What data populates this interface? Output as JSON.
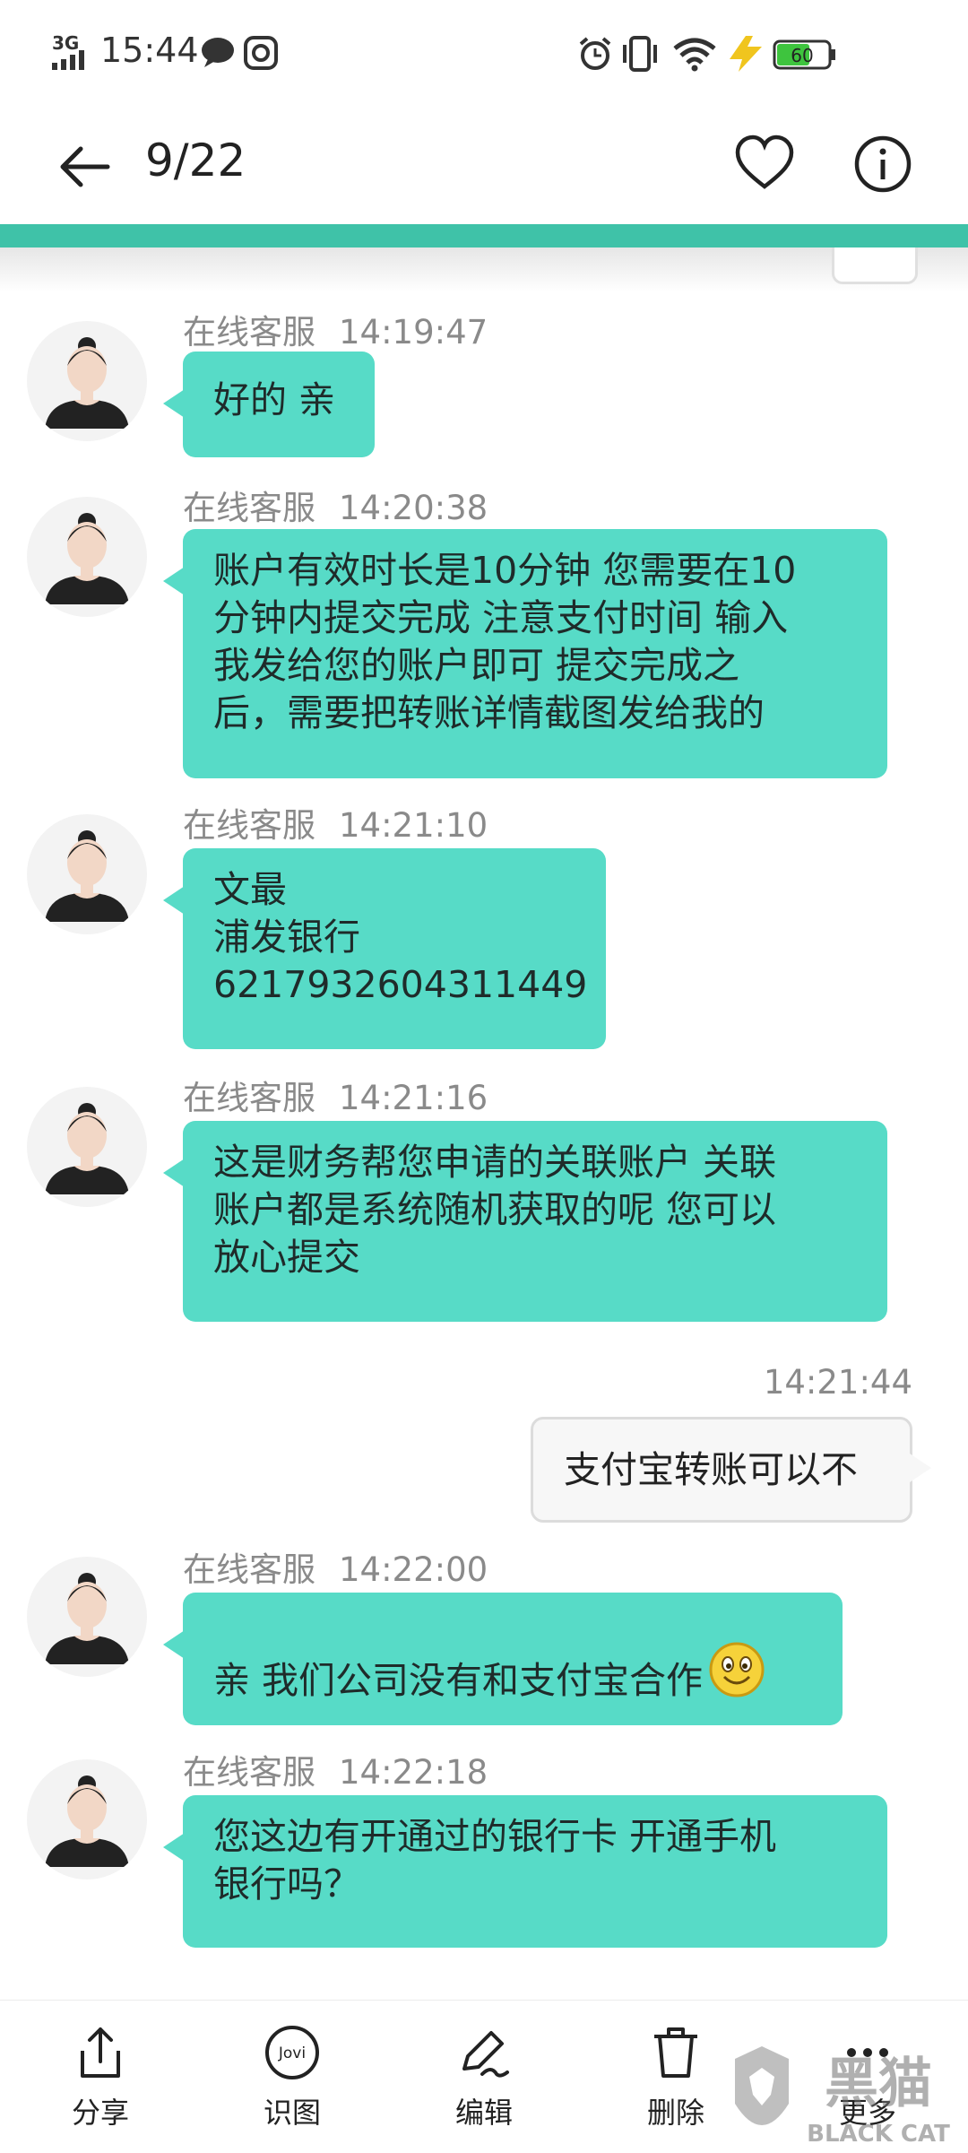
{
  "status_bar": {
    "network": "3G",
    "time": "15:44",
    "battery": "60"
  },
  "header": {
    "counter": "9/22"
  },
  "messages": [
    {
      "sender": "在线客服",
      "time": "14:19:47",
      "lines": [
        "好的 亲"
      ]
    },
    {
      "sender": "在线客服",
      "time": "14:20:38",
      "lines": [
        "账户有效时长是10分钟 您需要在10",
        "分钟内提交完成 注意支付时间 输入",
        "我发给您的账户即可 提交完成之",
        "后，需要把转账详情截图发给我的"
      ]
    },
    {
      "sender": "在线客服",
      "time": "14:21:10",
      "lines": [
        "文最",
        "浦发银行",
        "6217932604311449"
      ]
    },
    {
      "sender": "在线客服",
      "time": "14:21:16",
      "lines": [
        "这是财务帮您申请的关联账户 关联",
        "账户都是系统随机获取的呢 您可以",
        "放心提交"
      ]
    },
    {
      "sender": "在线客服",
      "time": "14:22:00",
      "lines": [
        "亲 我们公司没有和支付宝合作"
      ]
    },
    {
      "sender": "在线客服",
      "time": "14:22:18",
      "lines": [
        "您这边有开通过的银行卡 开通手机",
        "银行吗？"
      ]
    }
  ],
  "outgoing": {
    "time": "14:21:44",
    "text": "支付宝转账可以不"
  },
  "toolbar": {
    "share": "分享",
    "recognize": "识图",
    "edit": "编辑",
    "delete": "删除",
    "more": "更多"
  },
  "watermark": {
    "text": "黑猫",
    "sub": "BLACK CAT"
  },
  "colors": {
    "accent": "#3fc2a8",
    "bubble": "#57dbc7"
  }
}
